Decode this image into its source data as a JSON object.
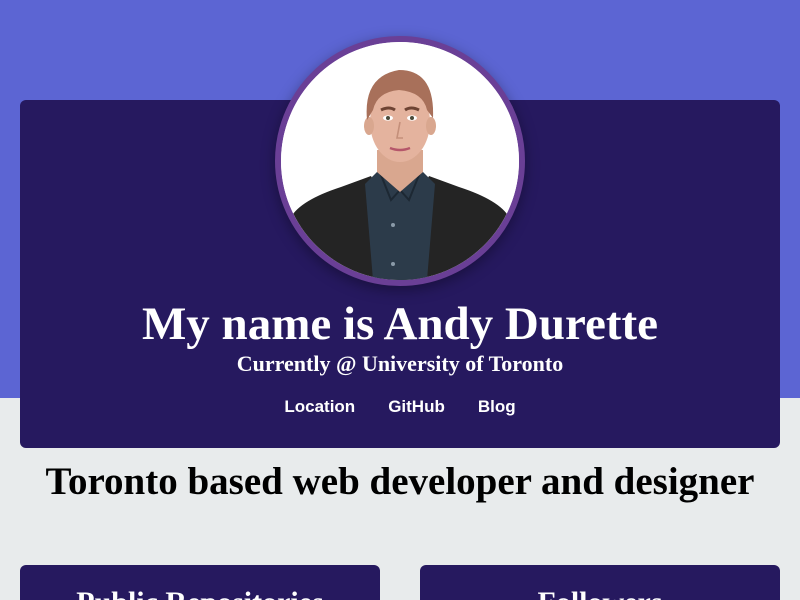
{
  "profile": {
    "avatar_alt": "Andy Durette avatar",
    "name": "My name is Andy Durette",
    "subtitle": "Currently @ University of Toronto"
  },
  "links": [
    {
      "label": "Location"
    },
    {
      "label": "GitHub"
    },
    {
      "label": "Blog"
    }
  ],
  "tagline": "Toronto based web developer and designer",
  "stats": [
    {
      "title": "Public Repositories"
    },
    {
      "title": "Followers"
    }
  ],
  "colors": {
    "band": "#5c65d3",
    "card": "#26195f",
    "page_bg": "#e8ebec",
    "avatar_ring": "#6a3f96"
  }
}
